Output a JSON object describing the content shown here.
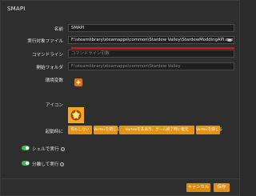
{
  "dialog": {
    "title": "SMAPI"
  },
  "form": {
    "name": {
      "label": "名前",
      "value": "SMAPI"
    },
    "target": {
      "label": "実行対象ファイル",
      "value": "F:\\steamlibrary\\steamapps\\common\\Stardew Valley\\StardewModdingAPI.exe",
      "browse_icon": "folder-icon"
    },
    "cmdline": {
      "label": "コマンドライン",
      "placeholder": "コマンドライン引数"
    },
    "workdir": {
      "label": "開始フォルダ",
      "value": "F:\\steamlibrary\\steamapps\\common\\Stardew Valley"
    },
    "env": {
      "label": "環境変数",
      "add_icon": "plus-icon"
    },
    "icon": {
      "label": "アイコン",
      "image": "stardew-valley-icon"
    },
    "on_launch": {
      "label": "起動時に",
      "options": [
        "何もしない",
        "Vortexを閉じる",
        "Vortexを非表示、ゲーム終了時に復元",
        "Vortexを隠じる"
      ]
    }
  },
  "toggles": [
    {
      "label": "シェルで実行",
      "state": "on"
    },
    {
      "label": "分離して実行",
      "state": "on"
    }
  ],
  "footer": {
    "cancel": "キャンセル",
    "save": "保存"
  },
  "colors": {
    "accent": "#e49312",
    "highlight": "#e0151b",
    "toggle_on": "#3fb950"
  }
}
